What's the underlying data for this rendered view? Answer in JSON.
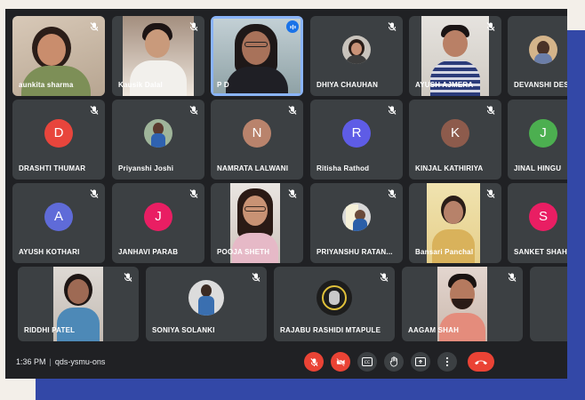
{
  "participants_row1": [
    {
      "name": "aunkita sharma"
    },
    {
      "name": "Kausik Dalal"
    },
    {
      "name": "P D"
    },
    {
      "name": "DHIYA CHAUHAN"
    },
    {
      "name": "AYUSH AJMERA"
    },
    {
      "name": "DEVANSHI DESA"
    }
  ],
  "participants_row2": [
    {
      "name": "DRASHTI THUMAR",
      "letter": "D",
      "color": "#e8453c"
    },
    {
      "name": "Priyanshi Joshi"
    },
    {
      "name": "NAMRATA LALWANI",
      "letter": "N",
      "color": "#b9836c"
    },
    {
      "name": "Ritisha Rathod",
      "letter": "R",
      "color": "#5e5ce6"
    },
    {
      "name": "KINJAL KATHIRIYA",
      "letter": "K",
      "color": "#8d5b4c"
    },
    {
      "name": "JINAL HINGU",
      "letter": "J",
      "color": "#4caf50"
    }
  ],
  "participants_row3": [
    {
      "name": "AYUSH KOTHARI",
      "letter": "A",
      "color": "#5f6bd8"
    },
    {
      "name": "JANHAVI PARAB",
      "letter": "J",
      "color": "#e91e63"
    },
    {
      "name": "POOJA SHETH"
    },
    {
      "name": "PRIYANSHU RATAN..."
    },
    {
      "name": "Bansari Panchal"
    },
    {
      "name": "SANKET SHAH",
      "letter": "S",
      "color": "#e91e63"
    }
  ],
  "participants_row4": [
    {
      "name": "RIDDHI PATEL"
    },
    {
      "name": "SONIYA SOLANKI"
    },
    {
      "name": "RAJABU RASHIDI MTAPULE"
    },
    {
      "name": "AAGAM SHAH"
    }
  ],
  "meeting": {
    "time": "1:36 PM",
    "separator": "|",
    "code": "qds-ysmu-ons"
  },
  "controls": {
    "colors": {
      "danger": "#ea4335",
      "neutral": "#3c4043",
      "speaking": "#8ab4f8"
    },
    "icons": [
      "mic-off-icon",
      "camera-off-icon",
      "captions-icon",
      "raise-hand-icon",
      "present-icon",
      "more-options-icon",
      "end-call-icon"
    ]
  }
}
